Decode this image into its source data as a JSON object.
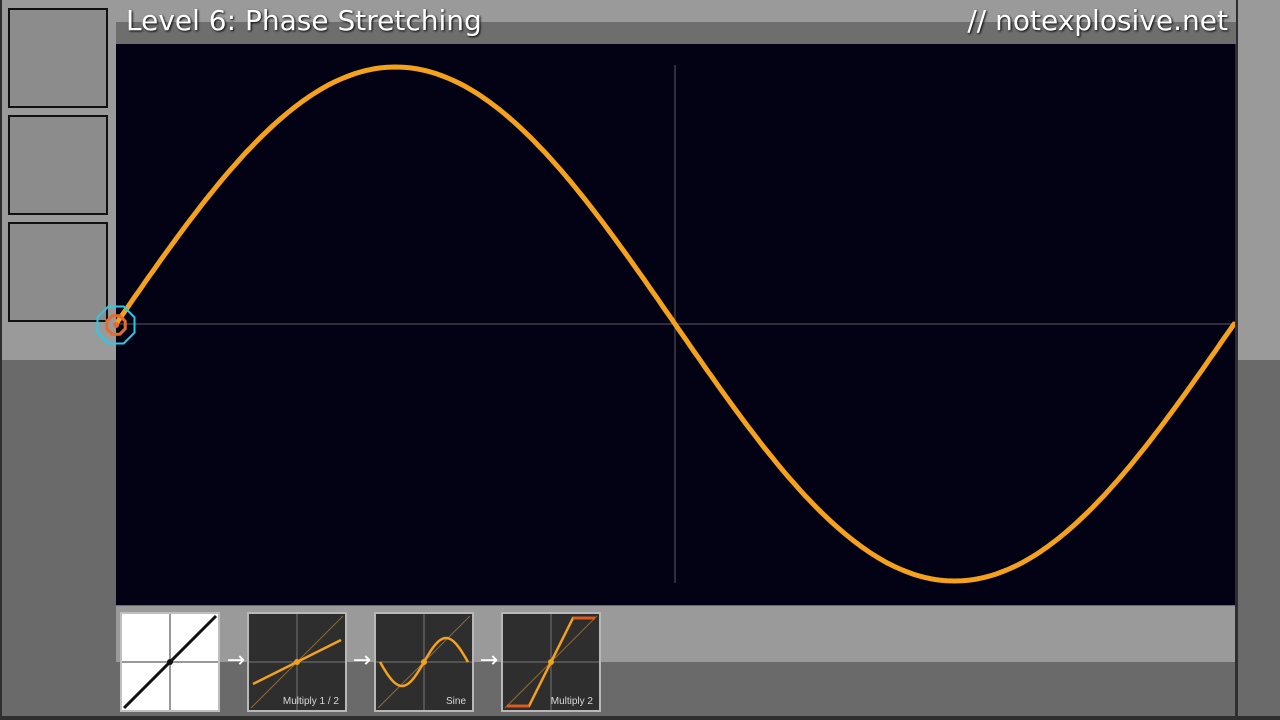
{
  "header": {
    "title": "Level 6: Phase Stretching",
    "site": "// notexplosive.net"
  },
  "colors": {
    "curve": "#f4a11c",
    "plot_background": "#030214",
    "axis": "#5a5a66",
    "marker_outer": "#29c9e8",
    "marker_inner": "#e86b2a"
  },
  "inventory": {
    "slots": [
      {},
      {},
      {}
    ]
  },
  "plot": {
    "function": "sine",
    "x_range": [
      -1,
      1
    ],
    "y_range": [
      -1,
      1
    ],
    "marker_icon": "target-ring-icon"
  },
  "pipeline": {
    "arrow_glyph": "→",
    "operations": [
      {
        "name": "input",
        "label": ""
      },
      {
        "name": "multiply-half",
        "label": "Multiply 1 / 2"
      },
      {
        "name": "sine",
        "label": "Sine"
      },
      {
        "name": "multiply-two",
        "label": "Multiply 2"
      }
    ]
  }
}
